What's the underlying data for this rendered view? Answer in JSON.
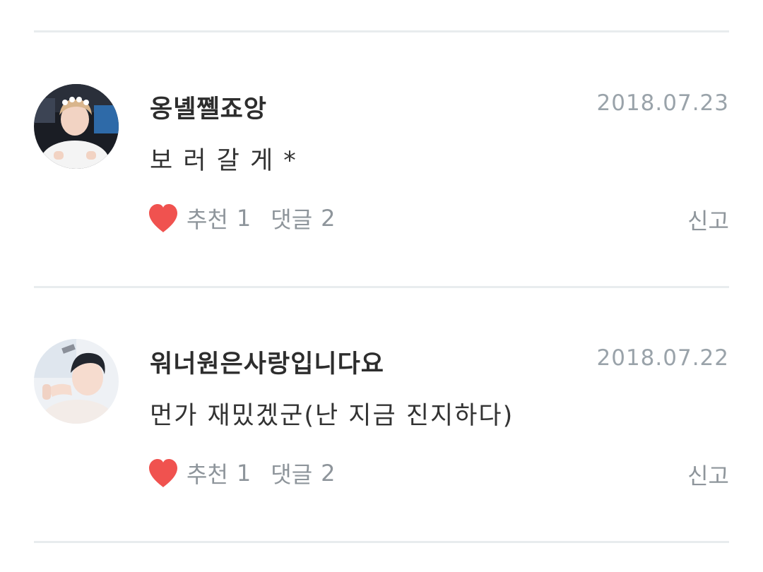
{
  "comments": [
    {
      "author": "옹녤쪨죠앙",
      "date": "2018.07.23",
      "text": "보 러 갈 게 *",
      "like_label": "추천",
      "like_count": "1",
      "reply_label": "댓글",
      "reply_count": "2",
      "report_label": "신고",
      "avatar_icon": "avatar-photo-icon"
    },
    {
      "author": "워너원은사랑입니다요",
      "date": "2018.07.22",
      "text": "먼가 재밌겠군(난 지금 진지하다)",
      "like_label": "추천",
      "like_count": "1",
      "reply_label": "댓글",
      "reply_count": "2",
      "report_label": "신고",
      "avatar_icon": "avatar-photo-icon"
    }
  ],
  "colors": {
    "heart": "#f0524f",
    "meta_text": "#8e959b",
    "date_text": "#9aa3aa",
    "divider": "#e8ecee"
  }
}
